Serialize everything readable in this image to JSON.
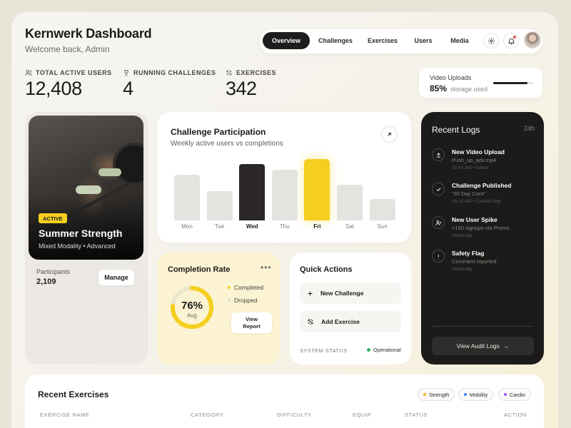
{
  "header": {
    "title": "Kernwerk Dashboard",
    "subtitle": "Welcome back, Admin"
  },
  "nav": {
    "tabs": [
      {
        "label": "Overview",
        "active": true
      },
      {
        "label": "Challenges",
        "active": false
      },
      {
        "label": "Exercises",
        "active": false
      },
      {
        "label": "Users",
        "active": false
      },
      {
        "label": "Media",
        "active": false
      }
    ],
    "icons": [
      "gear-icon",
      "bell-icon"
    ],
    "avatar": "user-avatar"
  },
  "stats": [
    {
      "label": "TOTAL ACTIVE USERS",
      "value": "12,408",
      "icon": "users-icon"
    },
    {
      "label": "RUNNING CHALLENGES",
      "value": "4",
      "icon": "trophy-icon"
    },
    {
      "label": "EXERCISES",
      "value": "342",
      "icon": "dumbbell-icon"
    }
  ],
  "uploads": {
    "title": "Video Uploads",
    "percent": "85%",
    "note": "storage used",
    "fraction": 0.85
  },
  "challenge": {
    "badge": "ACTIVE",
    "name": "Summer Strength",
    "meta": "Mixed Modality • Advanced",
    "participants_label": "Participants",
    "participants_value": "2,109",
    "manage_label": "Manage"
  },
  "participation": {
    "title": "Challenge Participation",
    "subtitle": "Weekly active users vs completions"
  },
  "chart_data": {
    "type": "bar",
    "categories": [
      "Mon",
      "Tue",
      "Wed",
      "Thu",
      "Fri",
      "Sat",
      "Sun"
    ],
    "values": [
      0.74,
      0.48,
      0.92,
      0.82,
      1.0,
      0.58,
      0.35
    ],
    "highlight": "Fri",
    "dark": "Wed",
    "colors": {
      "default": "#e4e3e0",
      "dark": "#2a2726",
      "highlight": "#f5cf1f"
    }
  },
  "completion": {
    "title": "Completion Rate",
    "more": "•••",
    "percent": "76%",
    "fraction": 0.76,
    "avg_label": "Avg",
    "legend": [
      {
        "label": "Completed",
        "color": "#f5cf1f"
      },
      {
        "label": "Dropped",
        "color": "#e2e0da"
      }
    ],
    "report_line1": "View",
    "report_line2": "Report"
  },
  "quick_actions": {
    "title": "Quick Actions",
    "items": [
      {
        "label": "New Challenge",
        "icon": "plus-icon"
      },
      {
        "label": "Add Exercise",
        "icon": "dumbbell-icon"
      }
    ],
    "status_label": "SYSTEM STATUS",
    "status_value": "Operational"
  },
  "logs": {
    "title": "Recent Logs",
    "range": "24h",
    "items": [
      {
        "title": "New Video Upload",
        "line": "Push_up_adv.mp4",
        "time": "10:42 AM • Admin",
        "icon": "upload-icon"
      },
      {
        "title": "Challenge Published",
        "line": "\"30 Day Core\"",
        "time": "09:15 AM • Content Mgr",
        "icon": "check-icon"
      },
      {
        "title": "New User Spike",
        "line": "+150 signups via Promo",
        "time": "Yesterday",
        "icon": "user-plus-icon"
      },
      {
        "title": "Safety Flag",
        "line": "Comment reported",
        "time": "Yesterday",
        "icon": "alert-icon"
      }
    ],
    "audit_label": "View Audit Logs",
    "audit_arrow": "→"
  },
  "recent": {
    "title": "Recent Exercises",
    "tags": [
      {
        "label": "Strength",
        "color": "#f5b81f"
      },
      {
        "label": "Mobility",
        "color": "#3b82f6"
      },
      {
        "label": "Cardio",
        "color": "#a855f7"
      }
    ],
    "columns": [
      "EXERCISE NAME",
      "CATEGORY",
      "DIFFICULTY",
      "EQUIP",
      "STATUS",
      "ACTION"
    ]
  }
}
